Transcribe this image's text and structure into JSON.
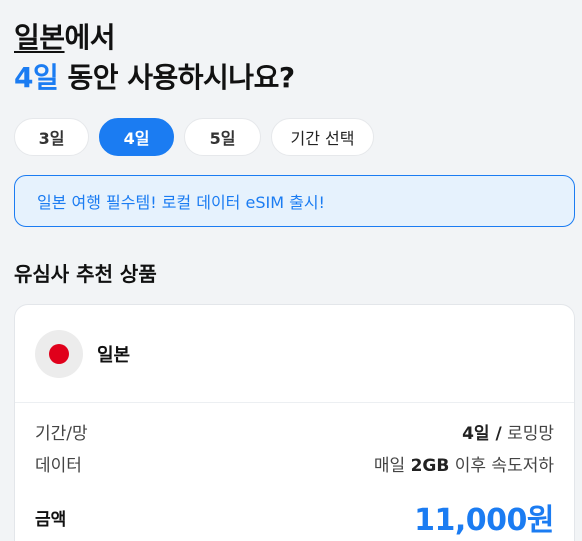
{
  "headline": {
    "country": "일본",
    "line1_suffix": "에서",
    "days": "4일",
    "line2_suffix": " 동안 사용하시나요?"
  },
  "duration_chips": [
    {
      "label": "3일",
      "selected": false
    },
    {
      "label": "4일",
      "selected": true
    },
    {
      "label": "5일",
      "selected": false
    },
    {
      "label": "기간 선택",
      "selected": false
    }
  ],
  "banner": {
    "text": "일본 여행 필수템! 로컬 데이터 eSIM 출시!"
  },
  "section_title": "유심사 추천 상품",
  "product": {
    "flag_icon": "japan-flag-icon",
    "name": "일본",
    "period_label": "기간/망",
    "period_value_bold": "4일 /",
    "period_value_rest": " 로밍망",
    "data_label": "데이터",
    "data_value_pre": "매일 ",
    "data_value_bold": "2GB",
    "data_value_post": " 이후 속도저하",
    "price_label": "금액",
    "price": "11,000원"
  },
  "colors": {
    "accent": "#1b7cf2",
    "background": "#f2f4f6",
    "banner_bg": "#e6f2fd"
  }
}
